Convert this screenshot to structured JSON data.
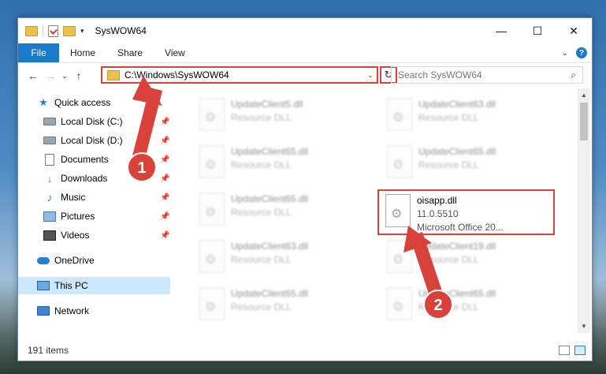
{
  "window": {
    "title": "SysWOW64",
    "controls": {
      "minimize": "—",
      "maximize": "☐",
      "close": "✕"
    }
  },
  "ribbon": {
    "file_tab": "File",
    "tabs": [
      "Home",
      "Share",
      "View"
    ],
    "help": "?"
  },
  "navigation": {
    "back": "←",
    "forward": "→",
    "recent": "⌄",
    "up": "↑",
    "address": "C:\\Windows\\SysWOW64",
    "refresh": "↻",
    "search_placeholder": "Search SysWOW64"
  },
  "sidebar": {
    "items": [
      {
        "label": "Quick access",
        "icon": "star-icon",
        "pinned": false
      },
      {
        "label": "Local Disk (C:)",
        "icon": "disk-icon",
        "pinned": true
      },
      {
        "label": "Local Disk (D:)",
        "icon": "disk-icon",
        "pinned": true
      },
      {
        "label": "Documents",
        "icon": "documents-icon",
        "pinned": true
      },
      {
        "label": "Downloads",
        "icon": "download-icon",
        "pinned": true
      },
      {
        "label": "Music",
        "icon": "music-icon",
        "pinned": true
      },
      {
        "label": "Pictures",
        "icon": "pictures-icon",
        "pinned": true
      },
      {
        "label": "Videos",
        "icon": "videos-icon",
        "pinned": true
      },
      {
        "label": "OneDrive",
        "icon": "cloud-icon",
        "pinned": false
      },
      {
        "label": "This PC",
        "icon": "computer-icon",
        "pinned": false,
        "selected": true
      },
      {
        "label": "Network",
        "icon": "network-icon",
        "pinned": false
      }
    ]
  },
  "files": [
    {
      "name": "UpdateClient5.dll",
      "type": "Resource DLL"
    },
    {
      "name": "UpdateClient63.dll",
      "type": "Resource DLL"
    },
    {
      "name": "UpdateClient65.dll",
      "type": "Resource DLL"
    },
    {
      "name": "UpdateClient65.dll",
      "type": "Resource DLL"
    },
    {
      "name": "UpdateClient65.dll",
      "type": "Resource DLL"
    },
    {
      "name": "oisapp.dll",
      "version": "11.0.5510",
      "type": "Microsoft Office 20...",
      "highlighted": true
    },
    {
      "name": "UpdateClient63.dll",
      "type": "Resource DLL"
    },
    {
      "name": "UpdateClient19.dll",
      "type": "Resource DLL"
    },
    {
      "name": "UpdateClient65.dll",
      "type": "Resource DLL"
    },
    {
      "name": "UpdateClient65.dll",
      "type": "Resource DLL"
    }
  ],
  "status": {
    "item_count": "191 items"
  },
  "callouts": [
    {
      "number": "1",
      "target": "address bar"
    },
    {
      "number": "2",
      "target": "oisapp.dll"
    }
  ],
  "colors": {
    "accent": "#1979ca",
    "highlight_border": "#d9413b",
    "selected_bg": "#cce8ff",
    "callout": "#d9413b"
  }
}
